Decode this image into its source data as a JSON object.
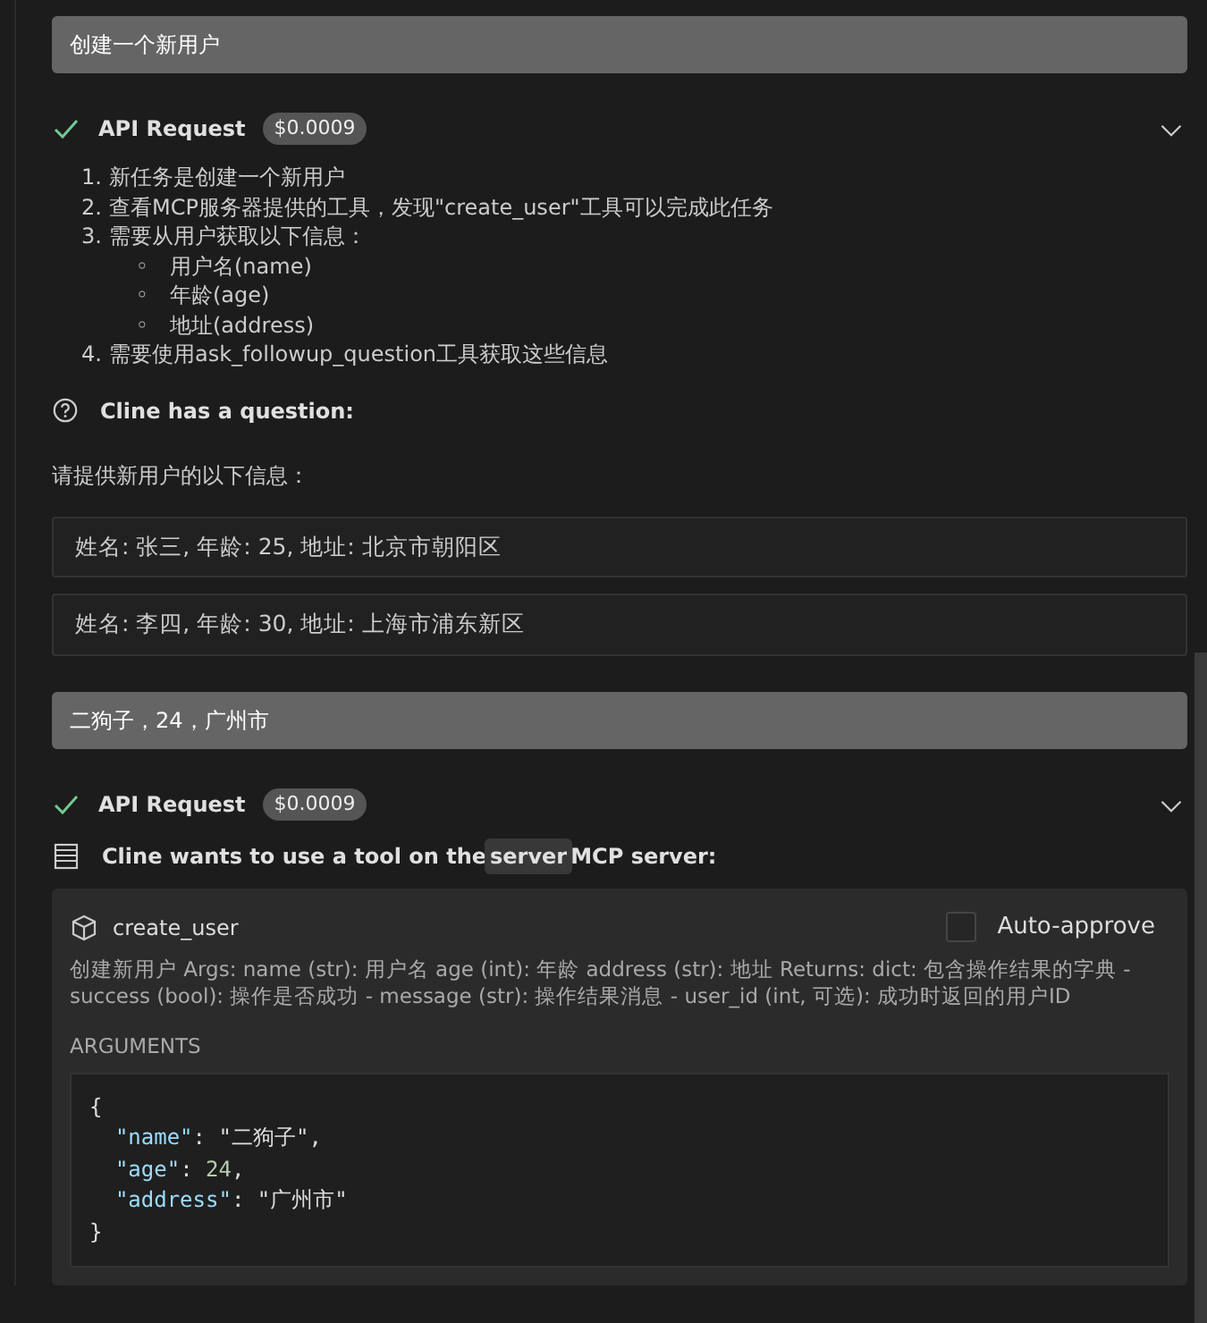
{
  "messages": [
    {
      "kind": "user",
      "text": "创建一个新用户"
    },
    {
      "kind": "api",
      "title": "API Request",
      "cost": "$0.0009",
      "done": true,
      "expanded": false
    },
    {
      "kind": "list",
      "items": [
        {
          "marker": "1.",
          "text": "新任务是创建一个新用户"
        },
        {
          "marker": "2.",
          "text": "查看MCP服务器提供的工具，发现\"create_user\"工具可以完成此任务"
        },
        {
          "marker": "3.",
          "text": "需要从用户获取以下信息：",
          "children": [
            {
              "marker": "◦",
              "text": "用户名(name)"
            },
            {
              "marker": "◦",
              "text": "年龄(age)"
            },
            {
              "marker": "◦",
              "text": "地址(address)"
            }
          ]
        },
        {
          "marker": "4.",
          "text": "需要使用ask_followup_question工具获取这些信息"
        }
      ]
    },
    {
      "kind": "question",
      "title": "Cline has a question:",
      "text": "请提供新用户的以下信息：",
      "options": [
        "姓名: 张三, 年龄: 25, 地址: 北京市朝阳区",
        "姓名: 李四, 年龄: 30, 地址: 上海市浦东新区"
      ]
    },
    {
      "kind": "user",
      "text": "二狗子，24，广州市"
    },
    {
      "kind": "api",
      "title": "API Request",
      "cost": "$0.0009",
      "done": true,
      "expanded": false
    },
    {
      "kind": "tool",
      "before": "Cline wants to use a tool on the",
      "server": "server",
      "after": "MCP server:",
      "tool_name": "create_user",
      "auto_approve": {
        "label": "Auto-approve",
        "checked": false
      },
      "description": "创建新用户 Args: name (str): 用户名 age (int): 年龄 address (str): 地址 Returns: dict: 包含操作结果的字典 - success (bool): 操作是否成功 - message (str): 操作结果消息 - user_id (int, 可选): 成功时返回的用户ID",
      "arguments_label": "ARGUMENTS",
      "code": {
        "open": "{",
        "entries": [
          [
            {
              "kind": "key",
              "text": "\"name\""
            },
            {
              "kind": "punct",
              "text": ": \"二狗子\","
            }
          ],
          [
            {
              "kind": "key",
              "text": "\"age\""
            },
            {
              "kind": "punct",
              "text": ": "
            },
            {
              "kind": "number",
              "text": "24"
            },
            {
              "kind": "punct",
              "text": ","
            }
          ],
          [
            {
              "kind": "key",
              "text": "\"address\""
            },
            {
              "kind": "punct",
              "text": ": \"广州市\""
            }
          ]
        ],
        "close": "}"
      }
    }
  ]
}
